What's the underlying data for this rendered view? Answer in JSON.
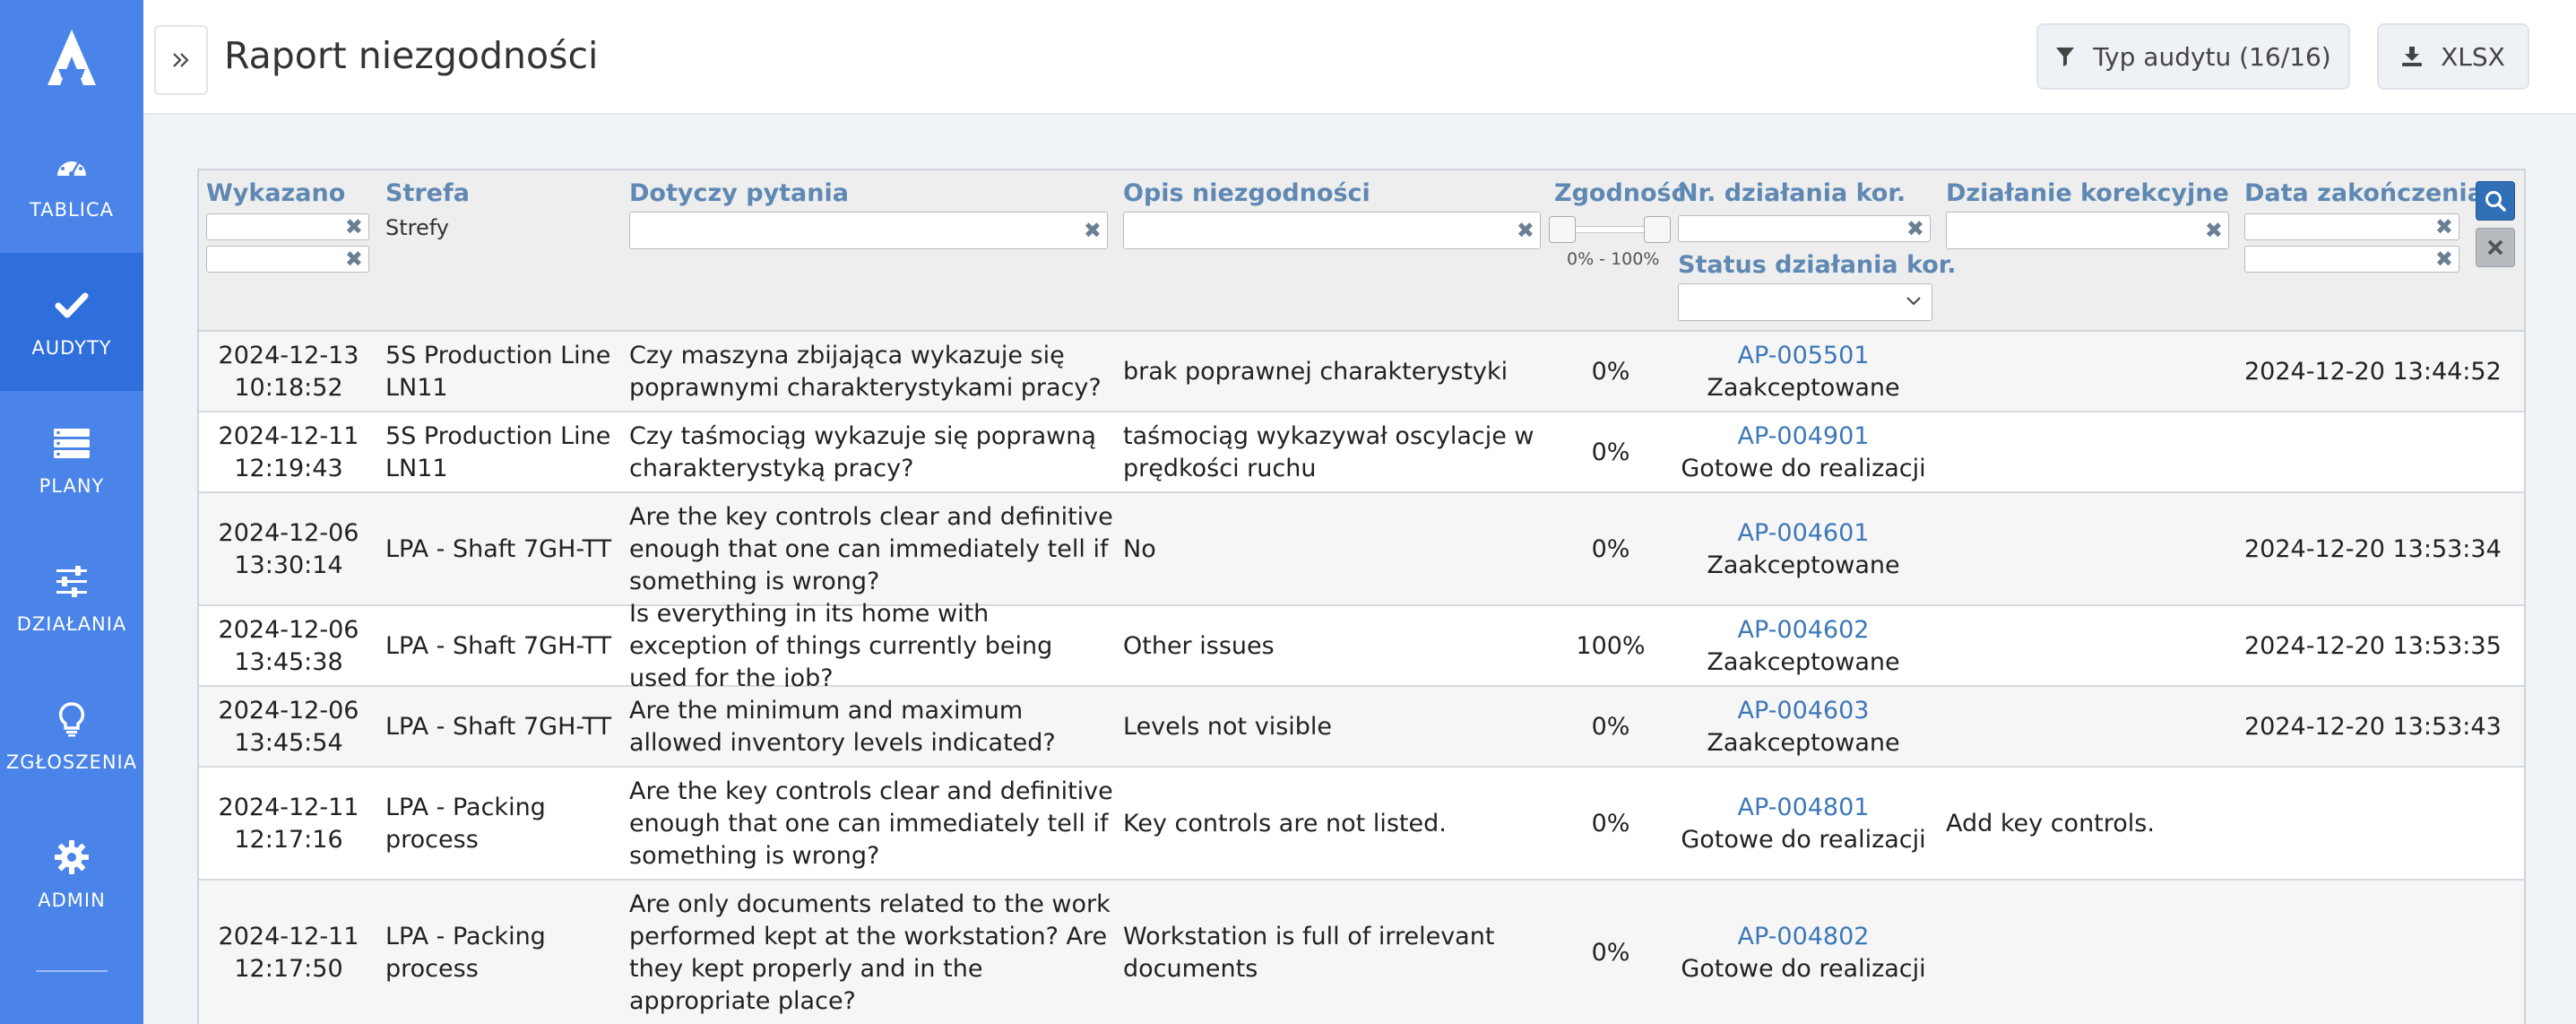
{
  "sidebar": {
    "logo": "A",
    "items": [
      {
        "label": "TABLICA",
        "icon": "dashboard-icon"
      },
      {
        "label": "AUDYTY",
        "icon": "check-icon",
        "active": true
      },
      {
        "label": "PLANY",
        "icon": "plans-icon"
      },
      {
        "label": "DZIAŁANIA",
        "icon": "sliders-icon"
      },
      {
        "label": "ZGŁOSZENIA",
        "icon": "lightbulb-icon"
      },
      {
        "label": "ADMIN",
        "icon": "gear-icon"
      }
    ]
  },
  "header": {
    "title": "Raport niezgodności",
    "audit_type_button": "Typ audytu (16/16)",
    "export_button": "XLSX"
  },
  "filters": {
    "wykazano": "Wykazano",
    "strefa": "Strefa",
    "strefa_value": "Strefy",
    "pytanie": "Dotyczy pytania",
    "opis": "Opis niezgodności",
    "zgodnosc": "Zgodność",
    "zgodnosc_range": "0% - 100%",
    "nr_dzialania": "Nr. działania kor.",
    "status_dzialania": "Status działania kor.",
    "dzialanie": "Działanie korekcyjne",
    "data_zakonczenia": "Data zakończenia"
  },
  "rows": [
    {
      "date": "2024-12-13",
      "time": "10:18:52",
      "zone": "5S Production Line LN11",
      "question": "Czy maszyna zbijająca wykazuje się poprawnymi charakterystykami pracy?",
      "description": "brak poprawnej charakterystyki",
      "compliance": "0%",
      "ap": "AP-005501",
      "status": "Zaakceptowane",
      "action": "",
      "end_date": "2024-12-20 13:44:52"
    },
    {
      "date": "2024-12-11",
      "time": "12:19:43",
      "zone": "5S Production Line LN11",
      "question": "Czy taśmociąg wykazuje się poprawną charakterystyką pracy?",
      "description": "taśmociąg wykazywał oscylacje w prędkości ruchu",
      "compliance": "0%",
      "ap": "AP-004901",
      "status": "Gotowe do realizacji",
      "action": "",
      "end_date": ""
    },
    {
      "date": "2024-12-06",
      "time": "13:30:14",
      "zone": "LPA - Shaft 7GH-TT",
      "question": "Are the key controls clear and definitive enough that one can immediately tell if something is wrong?",
      "description": "No",
      "compliance": "0%",
      "ap": "AP-004601",
      "status": "Zaakceptowane",
      "action": "",
      "end_date": "2024-12-20 13:53:34"
    },
    {
      "date": "2024-12-06",
      "time": "13:45:38",
      "zone": "LPA - Shaft 7GH-TT",
      "question": "Is everything in its home with exception of things currently being used for the job?",
      "description": "Other issues",
      "compliance": "100%",
      "ap": "AP-004602",
      "status": "Zaakceptowane",
      "action": "",
      "end_date": "2024-12-20 13:53:35"
    },
    {
      "date": "2024-12-06",
      "time": "13:45:54",
      "zone": "LPA - Shaft 7GH-TT",
      "question": "Are the minimum and maximum allowed inventory levels indicated?",
      "description": "Levels not visible",
      "compliance": "0%",
      "ap": "AP-004603",
      "status": "Zaakceptowane",
      "action": "",
      "end_date": "2024-12-20 13:53:43"
    },
    {
      "date": "2024-12-11",
      "time": "12:17:16",
      "zone": "LPA - Packing process",
      "question": "Are the key controls clear and definitive enough that one can immediately tell if something is wrong?",
      "description": "Key controls are not listed.",
      "compliance": "0%",
      "ap": "AP-004801",
      "status": "Gotowe do realizacji",
      "action": "Add key controls.",
      "end_date": ""
    },
    {
      "date": "2024-12-11",
      "time": "12:17:50",
      "zone": "LPA - Packing process",
      "question": "Are only documents related to the work performed kept at the workstation? Are they kept properly and in the appropriate place?",
      "description": "Workstation is full of irrelevant documents",
      "compliance": "0%",
      "ap": "AP-004802",
      "status": "Gotowe do realizacji",
      "action": "",
      "end_date": ""
    }
  ]
}
